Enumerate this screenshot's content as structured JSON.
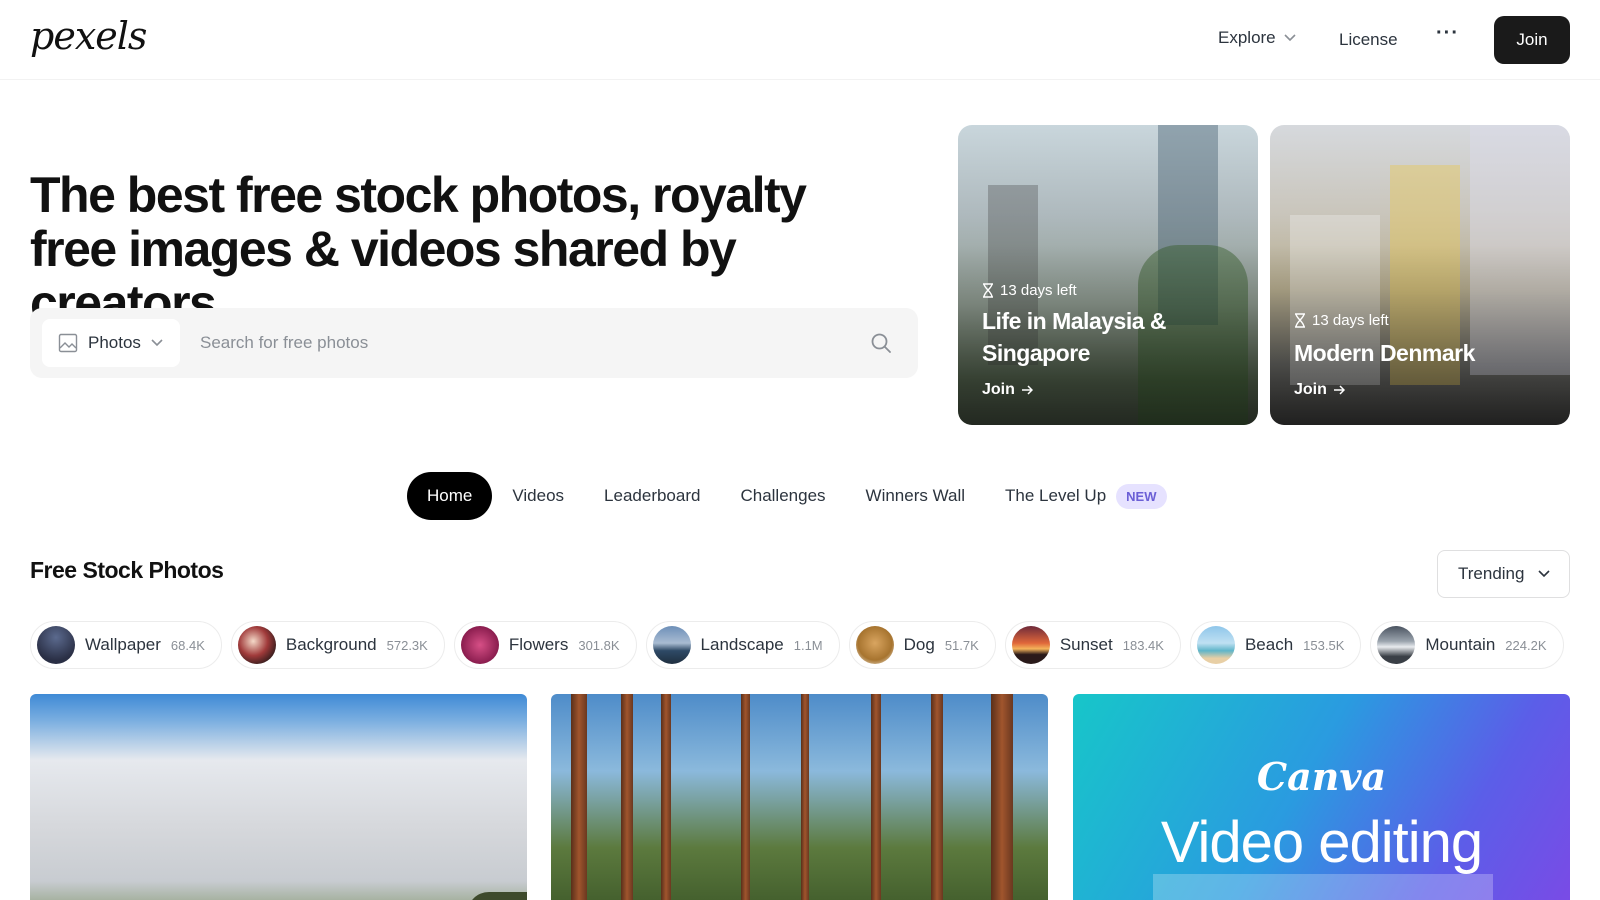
{
  "header": {
    "logo": "pexels",
    "nav": {
      "explore": "Explore",
      "license": "License",
      "more": "···"
    },
    "join": "Join"
  },
  "hero": {
    "title": "The best free stock photos, royalty free images & videos shared by creators."
  },
  "search": {
    "type": "Photos",
    "placeholder": "Search for free photos"
  },
  "challenges": [
    {
      "days": "13 days left",
      "title": "Life in Malaysia & Singapore",
      "join": "Join"
    },
    {
      "days": "13 days left",
      "title": "Modern Denmark",
      "join": "Join"
    }
  ],
  "tabs": [
    {
      "label": "Home",
      "active": true
    },
    {
      "label": "Videos"
    },
    {
      "label": "Leaderboard"
    },
    {
      "label": "Challenges"
    },
    {
      "label": "Winners Wall"
    },
    {
      "label": "The Level Up",
      "badge": "NEW"
    }
  ],
  "section": {
    "title": "Free Stock Photos",
    "sort": "Trending"
  },
  "topics": [
    {
      "label": "Wallpaper",
      "count": "68.4K"
    },
    {
      "label": "Background",
      "count": "572.3K"
    },
    {
      "label": "Flowers",
      "count": "301.8K"
    },
    {
      "label": "Landscape",
      "count": "1.1M"
    },
    {
      "label": "Dog",
      "count": "51.7K"
    },
    {
      "label": "Sunset",
      "count": "183.4K"
    },
    {
      "label": "Beach",
      "count": "153.5K"
    },
    {
      "label": "Mountain",
      "count": "224.2K"
    }
  ],
  "ad": {
    "brand": "Canva",
    "headline": "Video editing"
  },
  "colors": {
    "primary_dark": "#1a1a1a",
    "new_badge_bg": "#e6e2ff",
    "new_badge_text": "#6b5fd6",
    "search_bg": "#f5f5f5"
  }
}
